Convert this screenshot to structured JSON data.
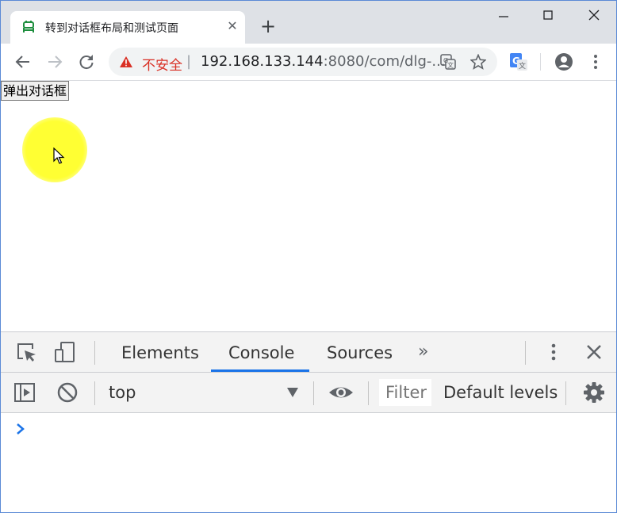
{
  "browser": {
    "tab": {
      "title": "转到对话框布局和测试页面",
      "close_glyph": "✕"
    },
    "new_tab_glyph": "+",
    "omnibox": {
      "security_label": "不安全",
      "separator": "|",
      "url_host": "192.168.133.144",
      "url_rest": ":8080/com/dlg-..."
    },
    "colors": {
      "tabstrip": "#dee1e6",
      "insecure": "#d93025",
      "accent": "#1a73e8"
    }
  },
  "page": {
    "popup_button_label": "弹出对话框"
  },
  "devtools": {
    "tabs": [
      {
        "label": "Elements",
        "active": false
      },
      {
        "label": "Console",
        "active": true
      },
      {
        "label": "Sources",
        "active": false
      }
    ],
    "more_tabs_glyph": "»",
    "console": {
      "context": "top",
      "filter_placeholder": "Filter",
      "levels": "Default levels"
    }
  }
}
